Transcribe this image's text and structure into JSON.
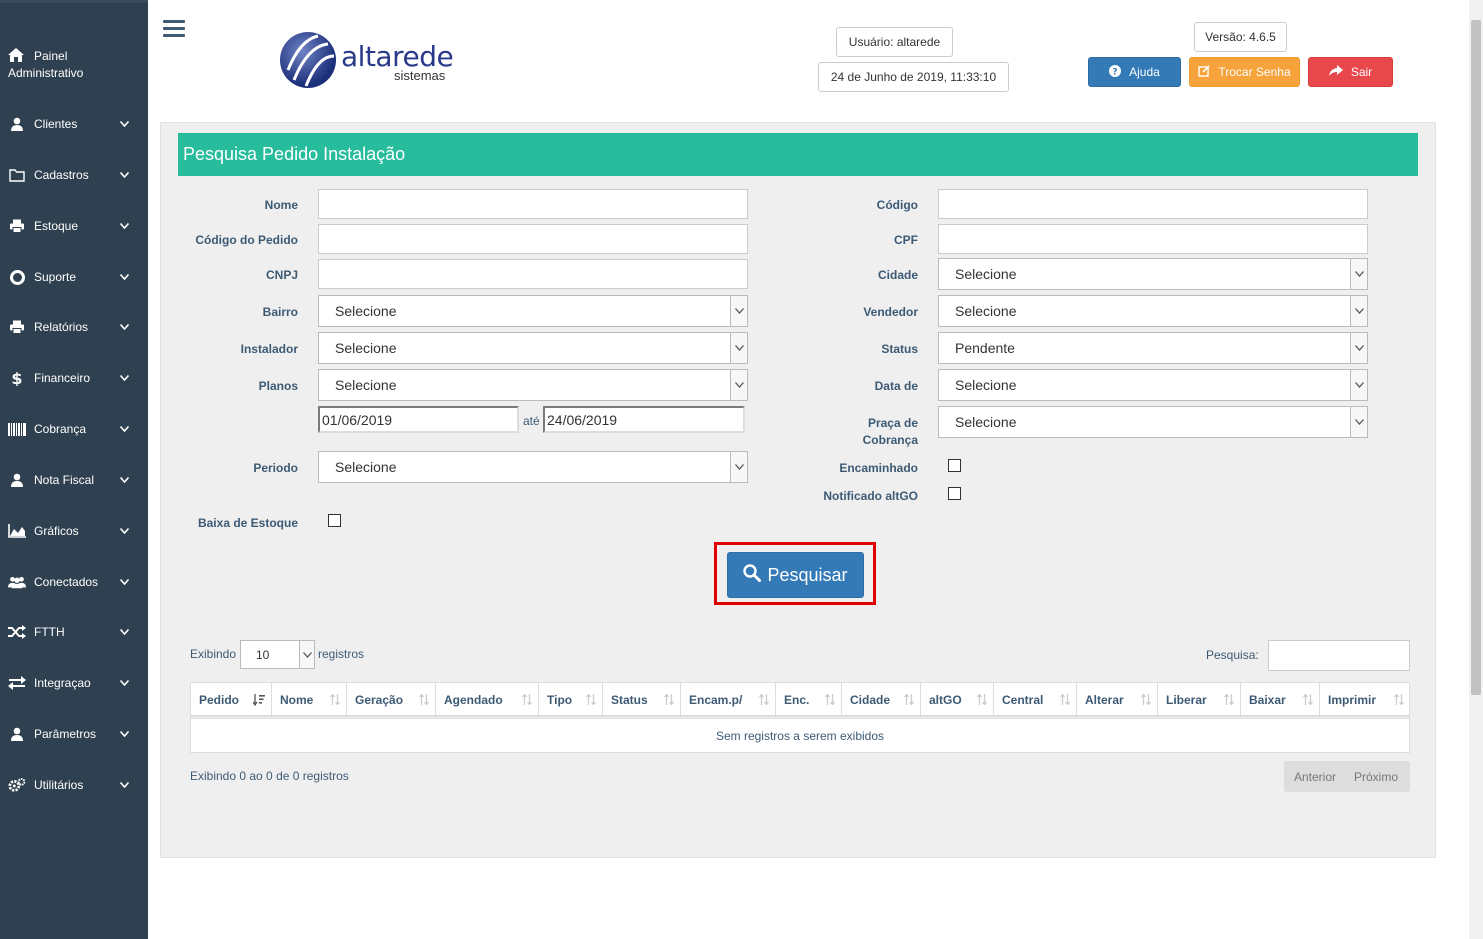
{
  "sidebar": {
    "painel_line1": "Painel",
    "painel_line2": "Administrativo",
    "items": [
      {
        "label": "Clientes"
      },
      {
        "label": "Cadastros"
      },
      {
        "label": "Estoque"
      },
      {
        "label": "Suporte"
      },
      {
        "label": "Relatórios"
      },
      {
        "label": "Financeiro"
      },
      {
        "label": "Cobrança"
      },
      {
        "label": "Nota Fiscal"
      },
      {
        "label": "Gráficos"
      },
      {
        "label": "Conectados"
      },
      {
        "label": "FTTH"
      },
      {
        "label": "Integraçao"
      },
      {
        "label": "Parâmetros"
      },
      {
        "label": "Utilitários"
      }
    ]
  },
  "header": {
    "logo_main": "altarede",
    "logo_sub": "sistemas",
    "user": "Usuário: altarede",
    "datetime": "24 de Junho de 2019, 11:33:10",
    "version": "Versão: 4.6.5",
    "help_label": "Ajuda",
    "change_password_label": "Trocar Senha",
    "logout_label": "Sair"
  },
  "colors": {
    "sidebar_bg": "#2f4050",
    "title_bar": "#26bc9c",
    "primary": "#337ab7",
    "warning": "#f7a33c",
    "danger": "#e8474b"
  },
  "form": {
    "title": "Pesquisa Pedido Instalação",
    "labels": {
      "nome": "Nome",
      "codigo_pedido": "Código do Pedido",
      "cnpj": "CNPJ",
      "bairro": "Bairro",
      "instalador": "Instalador",
      "planos": "Planos",
      "periodo": "Periodo",
      "baixa_estoque": "Baixa de Estoque",
      "codigo": "Código",
      "cpf": "CPF",
      "cidade": "Cidade",
      "vendedor": "Vendedor",
      "status": "Status",
      "data_de": "Data de",
      "praca_line1": "Praça de",
      "praca_line2": "Cobrança",
      "encaminhado": "Encaminhado",
      "notificado": "Notificado altGO",
      "ate": "até"
    },
    "values": {
      "bairro": "Selecione",
      "instalador": "Selecione",
      "planos": "Selecione",
      "periodo": "Selecione",
      "cidade": "Selecione",
      "vendedor": "Selecione",
      "status": "Pendente",
      "data_de": "Selecione",
      "praca": "Selecione",
      "date_from": "01/06/2019",
      "date_to": "24/06/2019"
    },
    "search_label": "Pesquisar"
  },
  "table": {
    "showing_prefix": "Exibindo",
    "page_size": "10",
    "showing_suffix": "registros",
    "search_label": "Pesquisa:",
    "columns": [
      "Pedido",
      "Nome",
      "Geração",
      "Agendado",
      "Tipo",
      "Status",
      "Encam.p/",
      "Enc.",
      "Cidade",
      "altGO",
      "Central",
      "Alterar",
      "Liberar",
      "Baixar",
      "Imprimir"
    ],
    "empty": "Sem registros a serem exibidos",
    "info": "Exibindo 0 ao 0 de 0 registros",
    "prev": "Anterior",
    "next": "Próximo"
  }
}
